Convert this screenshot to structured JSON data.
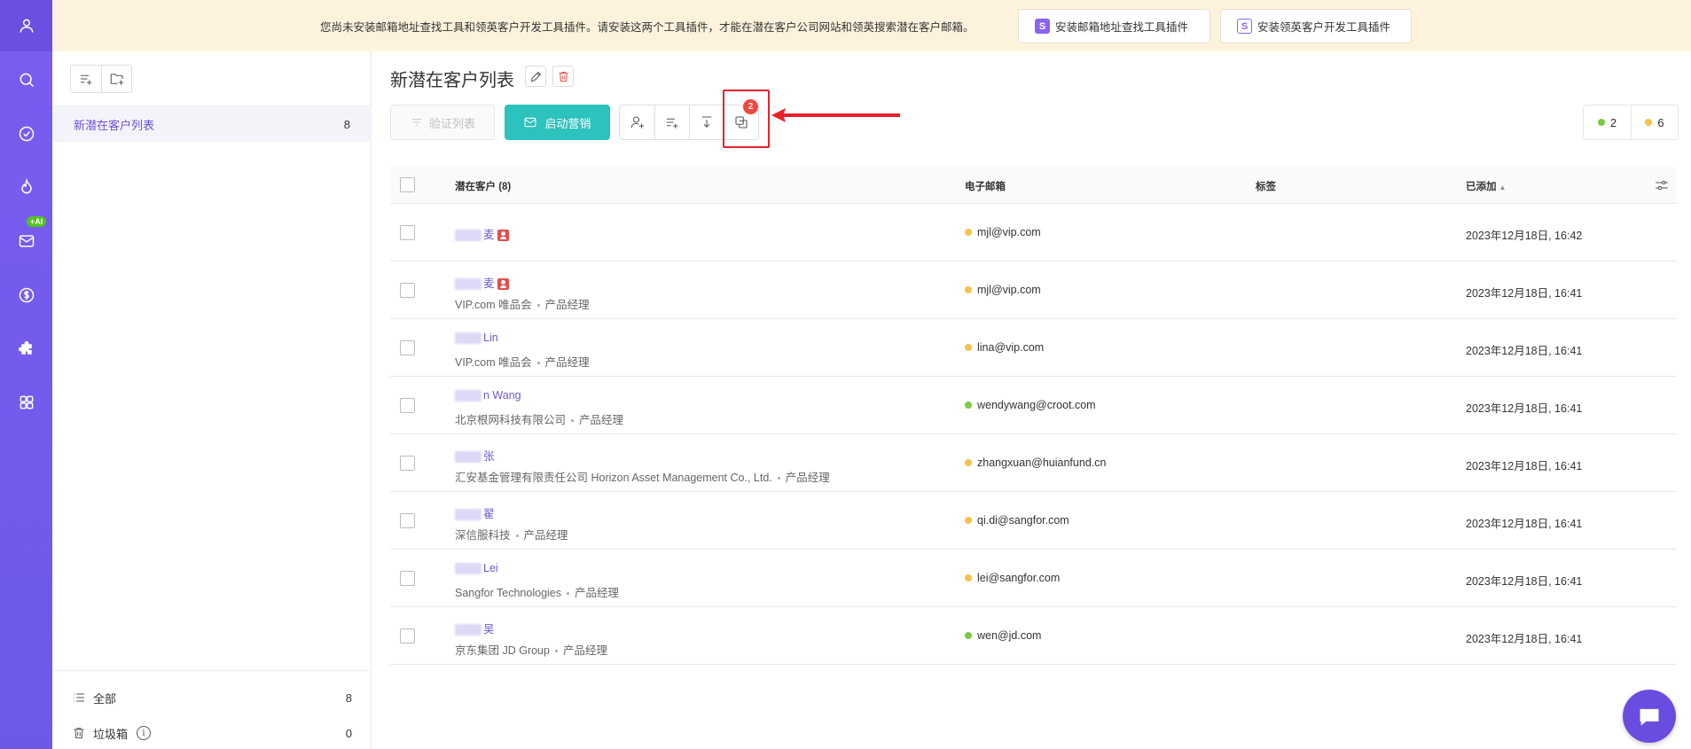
{
  "banner": {
    "text": "您尚未安装邮箱地址查找工具和领英客户开发工具插件。请安装这两个工具插件，才能在潜在客户公司网站和领英搜索潜在客户邮箱。",
    "btn1_label": "安装邮箱地址查找工具插件",
    "btn2_label": "安装领英客户开发工具插件",
    "btn_icon_letter": "S"
  },
  "sidebar": {
    "list_name": "新潜在客户列表",
    "list_count": "8",
    "all_label": "全部",
    "all_count": "8",
    "trash_label": "垃圾箱",
    "trash_count": "0",
    "info_glyph": "i"
  },
  "main": {
    "title": "新潜在客户列表",
    "verify_label": "验证列表",
    "start_label": "启动营销",
    "merge_badge": "2",
    "status_green_count": "2",
    "status_yellow_count": "6"
  },
  "table": {
    "col_prospect": "潜在客户 (8)",
    "col_email": "电子邮箱",
    "col_tags": "标签",
    "col_added": "已添加",
    "sort_glyph": "▲",
    "rows": [
      {
        "name": "麦",
        "sub_company": "",
        "sub_title": "",
        "email": "mjl@vip.com",
        "status": "yellow",
        "added": "2023年12月18日, 16:42",
        "has_contact_icon": true
      },
      {
        "name": "麦",
        "sub_company": "VIP.com 唯品会",
        "sub_title": "产品经理",
        "email": "mjl@vip.com",
        "status": "yellow",
        "added": "2023年12月18日, 16:41",
        "has_contact_icon": true
      },
      {
        "name": "Lin",
        "sub_company": "VIP.com 唯品会",
        "sub_title": "产品经理",
        "email": "lina@vip.com",
        "status": "yellow",
        "added": "2023年12月18日, 16:41"
      },
      {
        "name": "n Wang",
        "sub_company": "北京根网科技有限公司",
        "sub_title": "产品经理",
        "email": "wendywang@croot.com",
        "status": "green",
        "added": "2023年12月18日, 16:41"
      },
      {
        "name": "张",
        "sub_company": "汇安基金管理有限责任公司 Horizon Asset Management Co., Ltd.",
        "sub_title": "产品经理",
        "email": "zhangxuan@huianfund.cn",
        "status": "yellow",
        "added": "2023年12月18日, 16:41"
      },
      {
        "name": "翟",
        "sub_company": "深信服科技",
        "sub_title": "产品经理",
        "email": "qi.di@sangfor.com",
        "status": "yellow",
        "added": "2023年12月18日, 16:41"
      },
      {
        "name": "Lei",
        "sub_company": "Sangfor Technologies",
        "sub_title": "产品经理",
        "email": "lei@sangfor.com",
        "status": "yellow",
        "added": "2023年12月18日, 16:41"
      },
      {
        "name": "吴",
        "sub_company": "京东集团 JD Group",
        "sub_title": "产品经理",
        "email": "wen@jd.com",
        "status": "green",
        "added": "2023年12月18日, 16:41"
      }
    ]
  },
  "rail": {
    "ai_badge": "+AI"
  },
  "colors": {
    "brand_purple": "#7b5cf0",
    "teal": "#2cc2bd",
    "status_green": "#7ac943",
    "status_yellow": "#f5c24c",
    "highlight_red": "#e8202a"
  }
}
